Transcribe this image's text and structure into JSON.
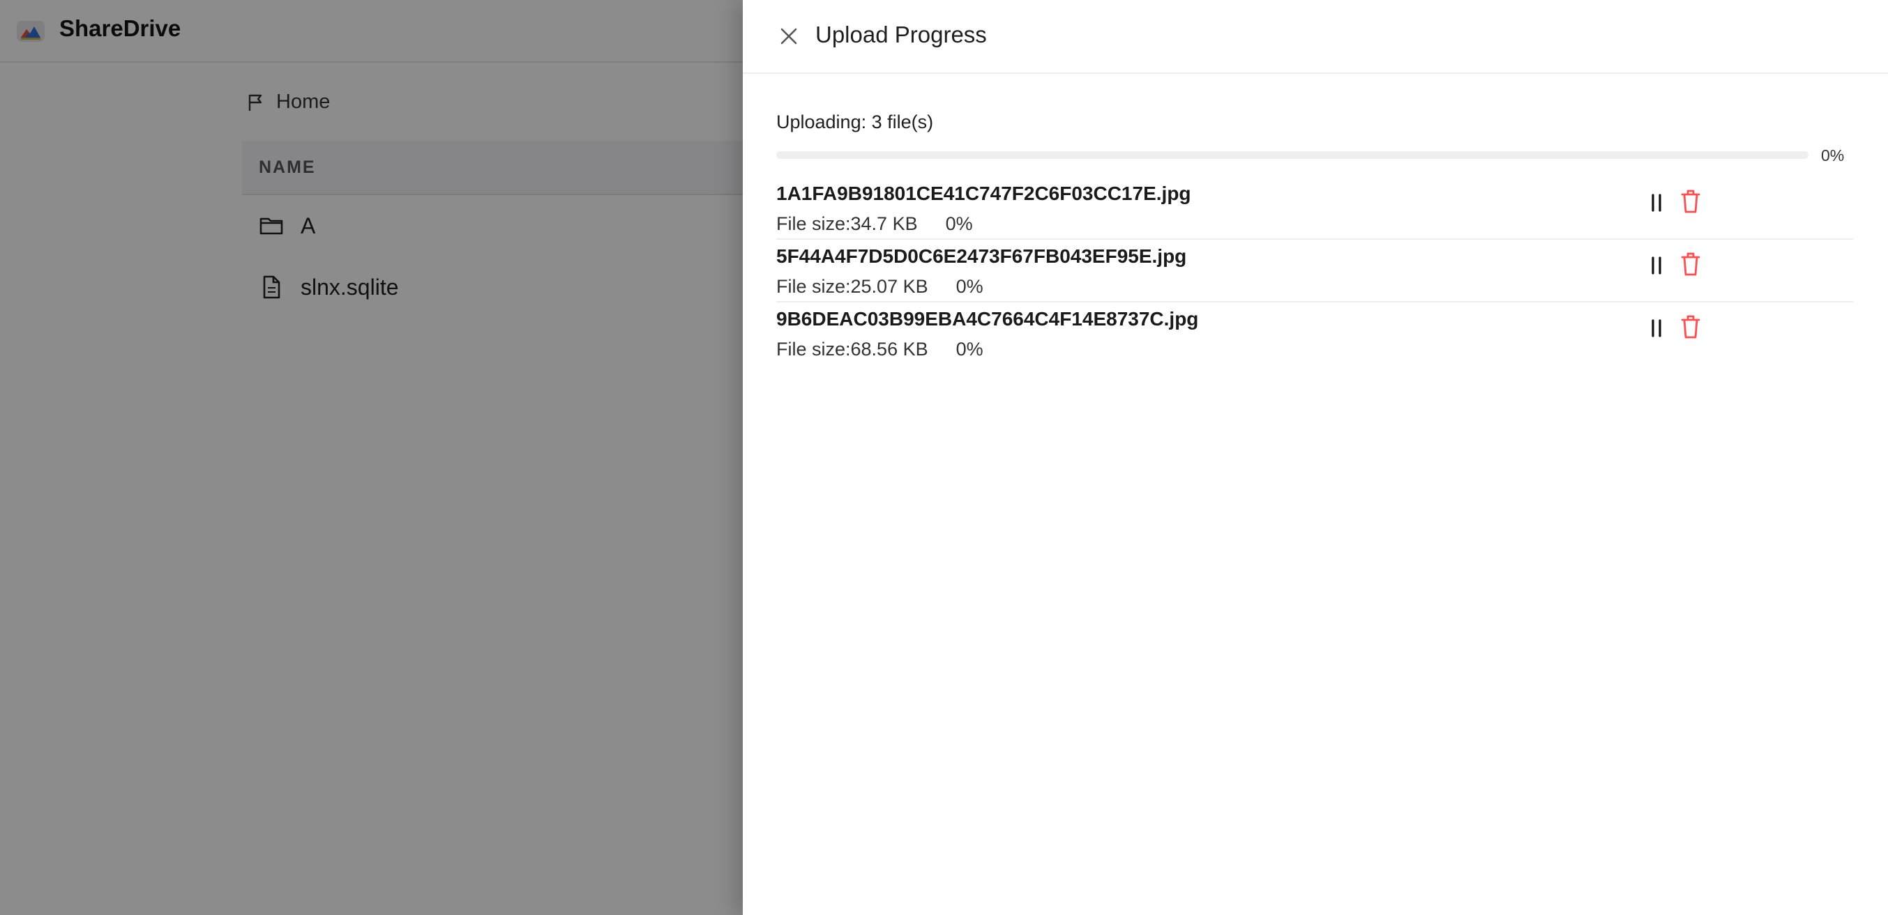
{
  "app": {
    "brand": "ShareDrive"
  },
  "breadcrumb": {
    "home_label": "Home"
  },
  "table": {
    "column_name": "NAME",
    "rows": [
      {
        "name": "A",
        "icon": "folder-icon"
      },
      {
        "name": "slnx.sqlite",
        "icon": "file-icon"
      }
    ]
  },
  "drawer": {
    "title": "Upload Progress",
    "summary": "Uploading: 3 file(s)",
    "overall_progress": 0,
    "overall_percent": "0%",
    "files": [
      {
        "name": "1A1FA9B91801CE41C747F2C6F03CC17E.jpg",
        "size": "File size:34.7 KB",
        "percent": "0%",
        "progress": 0
      },
      {
        "name": "5F44A4F7D5D0C6E2473F67FB043EF95E.jpg",
        "size": "File size:25.07 KB",
        "percent": "0%",
        "progress": 0
      },
      {
        "name": "9B6DEAC03B99EBA4C7664C4F14E8737C.jpg",
        "size": "File size:68.56 KB",
        "percent": "0%",
        "progress": 0
      }
    ]
  },
  "colors": {
    "overlay": "#000000",
    "accent": "#1677ff",
    "danger": "#ff4d4f"
  }
}
